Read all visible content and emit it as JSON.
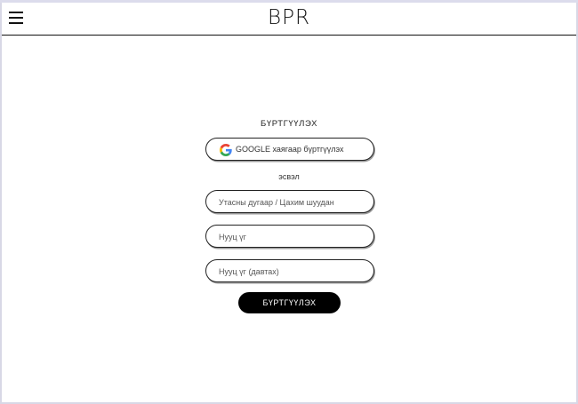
{
  "header": {
    "brand": "BPR",
    "menu_icon": "hamburger-menu-icon"
  },
  "form": {
    "title": "БҮРТГҮҮЛЭХ",
    "google_button_label": "GOOGLE хаягаар бүртгүүлэх",
    "google_icon": "google-logo-icon",
    "or_text": "эсвэл",
    "phone_email_placeholder": "Утасны дугаар / Цахим шуудан",
    "password_placeholder": "Нууц үг",
    "password_confirm_placeholder": "Нууц үг (давтах)",
    "submit_label": "БҮРТГҮҮЛЭХ"
  }
}
